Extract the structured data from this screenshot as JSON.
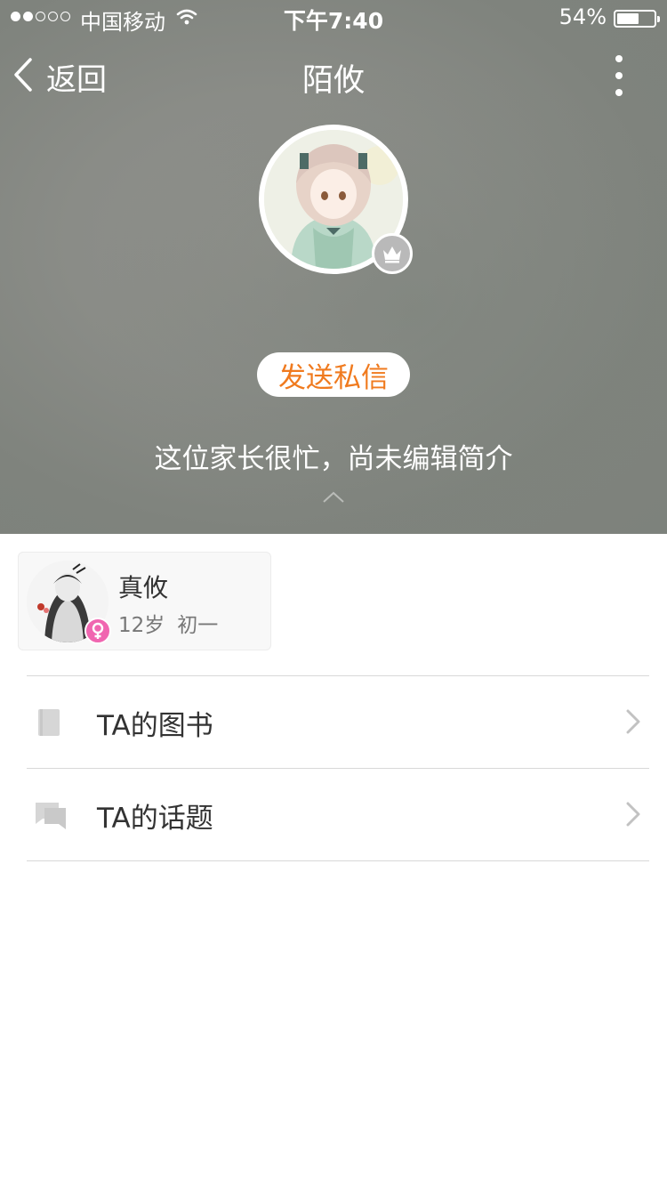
{
  "status_bar": {
    "signal_dots_filled": 2,
    "signal_dots_total": 5,
    "carrier": "中国移动",
    "time": "下午7:40",
    "battery_percent_text": "54%",
    "battery_level": 0.54
  },
  "nav": {
    "back_label": "返回",
    "title": "陌攸"
  },
  "profile": {
    "send_message_label": "发送私信",
    "bio": "这位家长很忙，尚未编辑简介"
  },
  "child": {
    "name": "真攸",
    "age": "12岁",
    "grade": "初一"
  },
  "menu": {
    "items": [
      {
        "label": "TA的图书",
        "icon": "book-icon"
      },
      {
        "label": "TA的话题",
        "icon": "topics-icon"
      }
    ]
  },
  "colors": {
    "accent_orange": "#f07a1e",
    "female_badge": "#f066b0",
    "header_gray": "#8a8c87"
  }
}
